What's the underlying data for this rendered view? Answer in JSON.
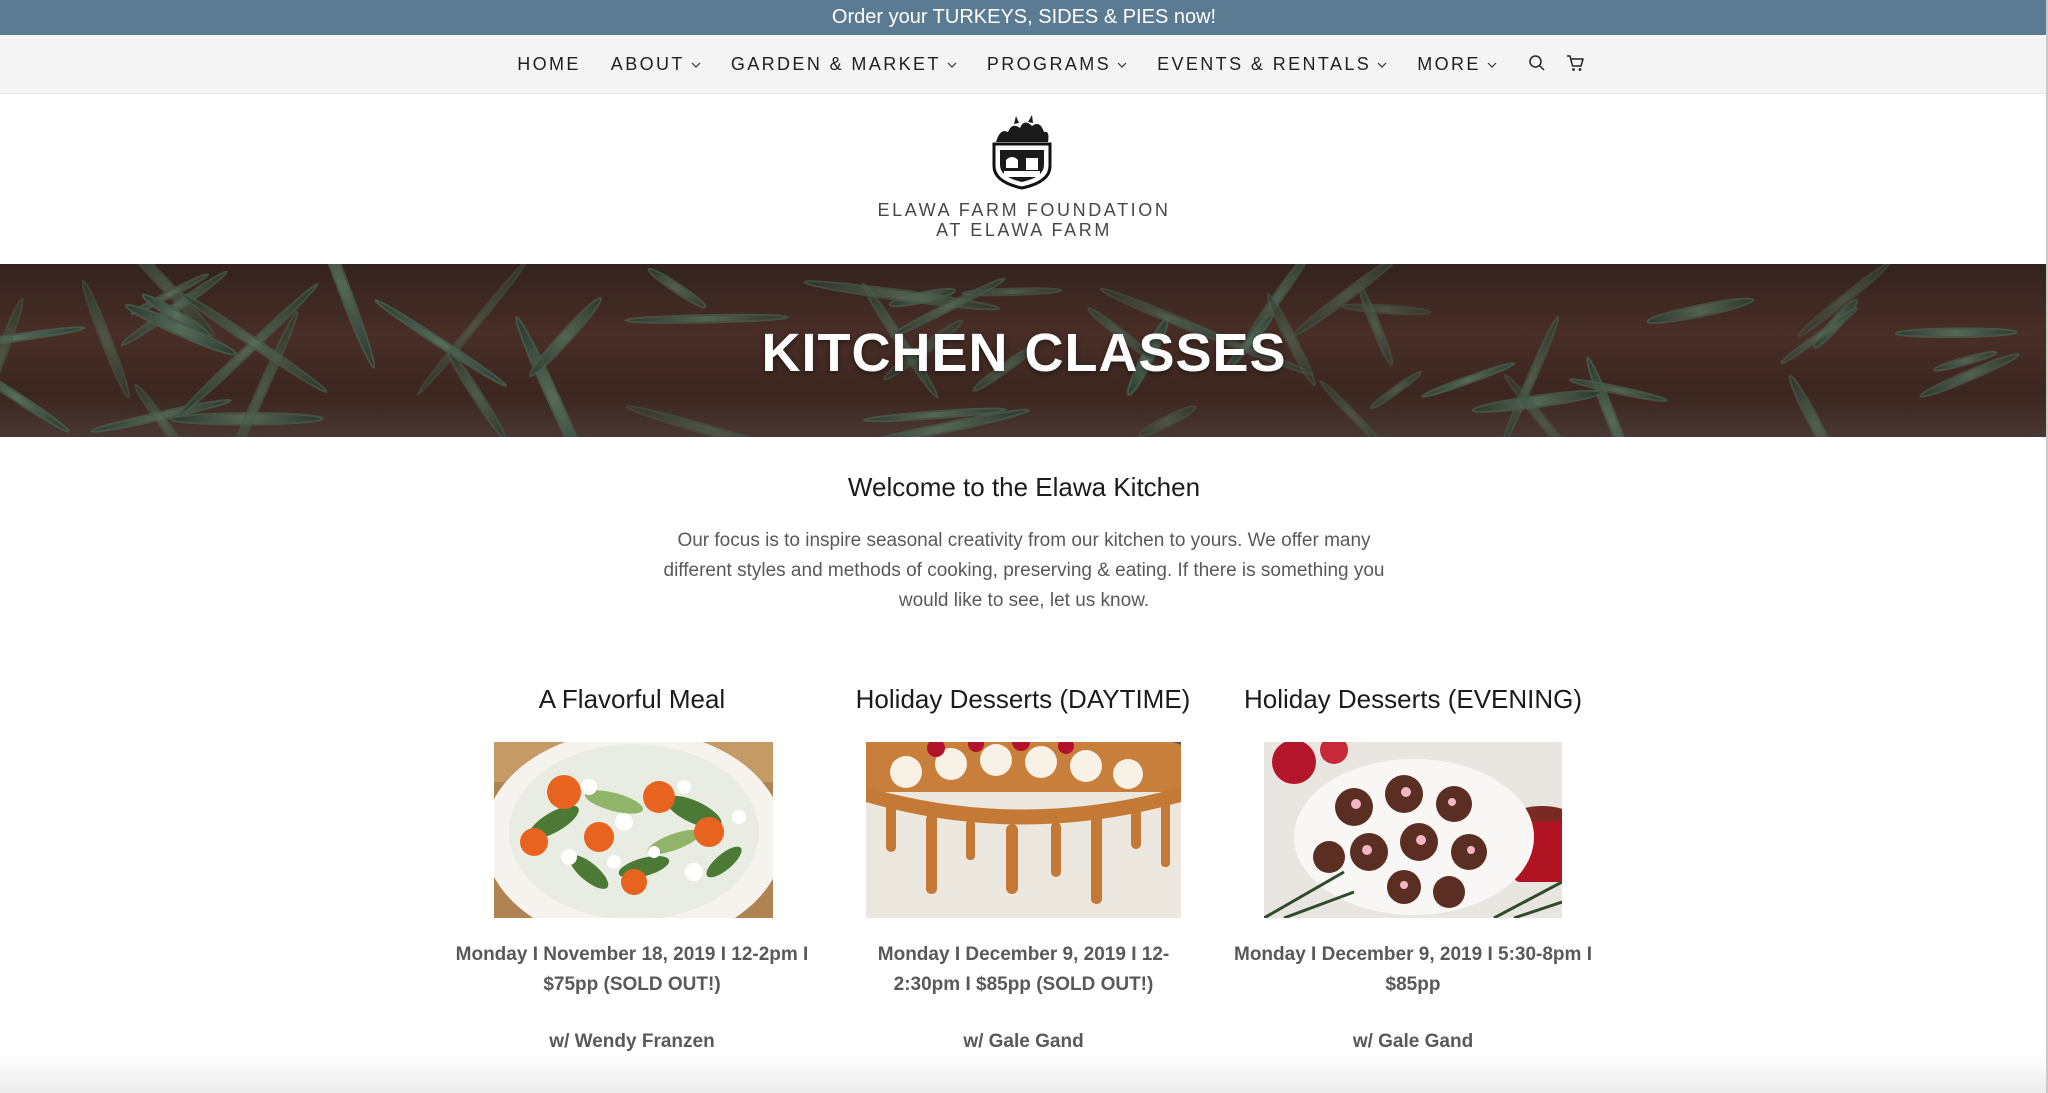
{
  "announcement": "Order your TURKEYS, SIDES & PIES now!",
  "nav": {
    "items": [
      {
        "label": "HOME",
        "dropdown": false
      },
      {
        "label": "ABOUT",
        "dropdown": true
      },
      {
        "label": "GARDEN & MARKET",
        "dropdown": true
      },
      {
        "label": "PROGRAMS",
        "dropdown": true
      },
      {
        "label": "EVENTS & RENTALS",
        "dropdown": true
      },
      {
        "label": "MORE",
        "dropdown": true
      }
    ],
    "icons": [
      "search-icon",
      "cart-icon"
    ]
  },
  "brand": {
    "line1": "ELAWA FARM FOUNDATION",
    "line2": "AT ELAWA FARM",
    "logo_text": "ELAWA FARM"
  },
  "hero": {
    "title": "KITCHEN CLASSES"
  },
  "welcome": {
    "title": "Welcome to the Elawa Kitchen",
    "body": "Our focus is to inspire seasonal creativity from our kitchen to yours. We offer many different styles and methods of cooking, preserving & eating. If there is something you would like to see, let us know."
  },
  "classes": [
    {
      "title": "A Flavorful Meal",
      "date": "Monday I November 18, 2019 I 12-2pm I $75pp (SOLD OUT!)",
      "host": "w/ Wendy Franzen",
      "image": "salad-photo"
    },
    {
      "title": "Holiday Desserts (DAYTIME)",
      "date": "Monday I December 9, 2019 I 12-2:30pm I $85pp (SOLD OUT!)",
      "host": "w/ Gale Gand",
      "image": "caramel-cake-photo"
    },
    {
      "title": "Holiday Desserts (EVENING)",
      "date": "Monday I December 9, 2019 I 5:30-8pm I $85pp",
      "host": "w/ Gale Gand",
      "image": "peppermint-cookies-photo"
    }
  ],
  "colors": {
    "announcement_bg": "#5a7b92",
    "nav_bg": "#f4f4f4",
    "text_dark": "#1b1b1b",
    "text_muted": "#595959"
  }
}
